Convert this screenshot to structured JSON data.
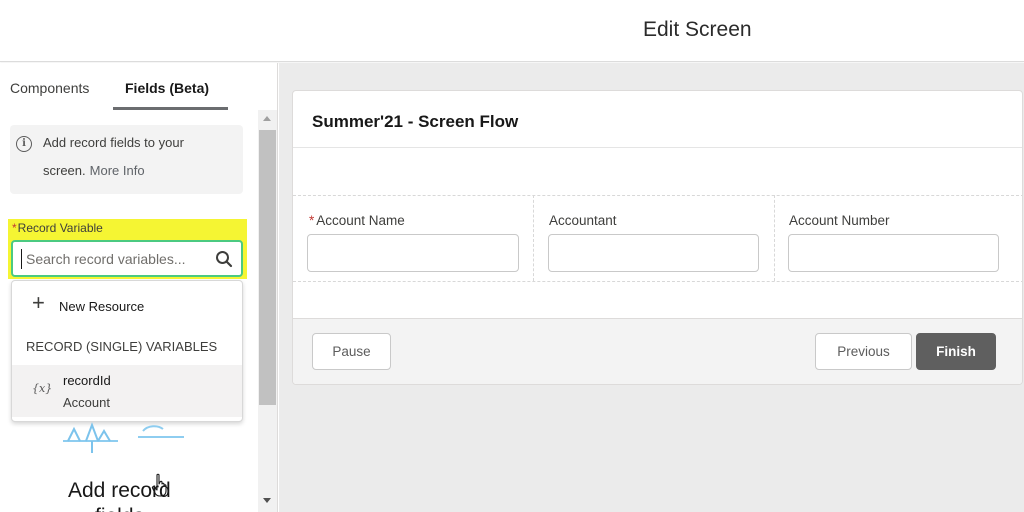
{
  "header": {
    "title": "Edit Screen"
  },
  "left_panel": {
    "tabs": [
      {
        "label": "Components",
        "active": false
      },
      {
        "label": "Fields (Beta)",
        "active": true
      }
    ],
    "info": {
      "line1": "Add record fields to your",
      "line2": "screen.",
      "more_link": "More Info"
    },
    "record_variable": {
      "label": "Record Variable",
      "required_marker": "*",
      "placeholder": "Search record variables..."
    },
    "dropdown": {
      "new_resource": "New Resource",
      "section_header": "RECORD (SINGLE) VARIABLES",
      "items": [
        {
          "icon": "{x}",
          "name": "recordId",
          "type": "Account"
        }
      ]
    },
    "empty_state": {
      "line1": "Add record",
      "line2": "fields"
    }
  },
  "canvas": {
    "flow_title": "Summer'21 - Screen Flow",
    "fields": [
      {
        "label": "Account Name",
        "required": true,
        "required_marker": "*"
      },
      {
        "label": "Accountant",
        "required": false
      },
      {
        "label": "Account Number",
        "required": false
      }
    ],
    "buttons": {
      "pause": "Pause",
      "previous": "Previous",
      "finish": "Finish"
    }
  },
  "colors": {
    "highlight": "#f5f533",
    "search_border": "#4bca81",
    "finish_bg": "#5f5f5f",
    "required": "#c23934"
  }
}
